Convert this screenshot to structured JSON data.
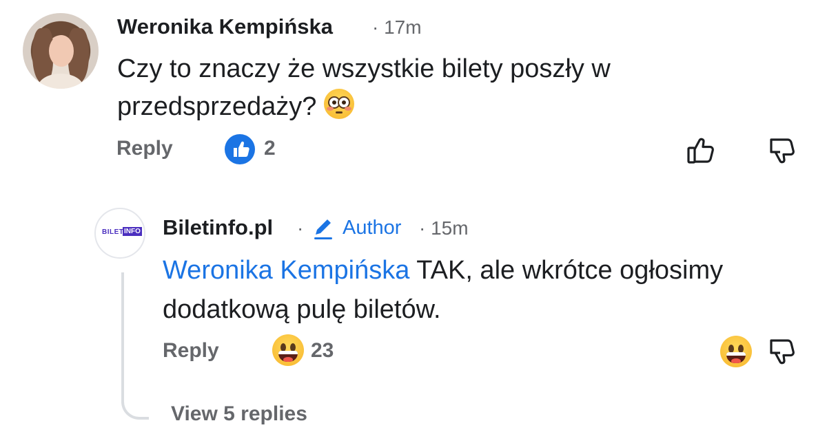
{
  "comment": {
    "author": "Weronika Kempińska",
    "meta": "· 17m",
    "text": "Czy to znaczy że wszystkie bilety poszły w przedsprzedaży?",
    "reply_label": "Reply",
    "like_count": "2",
    "reaction_icon": "like-icon",
    "avatar_icon": "user-photo"
  },
  "reply": {
    "author": "Biletinfo.pl",
    "meta_dot": "·",
    "author_badge": "Author",
    "meta": "· 15m",
    "logo_text_1": "BILET",
    "logo_text_2": "INFO",
    "mention": "Weronika Kempińska",
    "text": " TAK, ale wkrótce ogłosimy dodatkową pulę biletów.",
    "reply_label": "Reply",
    "reaction_count": "23",
    "reaction_icon": "haha-icon"
  },
  "thread": {
    "view_replies": "View 5 replies"
  },
  "colors": {
    "link_blue": "#1b74e4",
    "meta_gray": "#65676b",
    "brand_purple": "#4b2fbf"
  }
}
